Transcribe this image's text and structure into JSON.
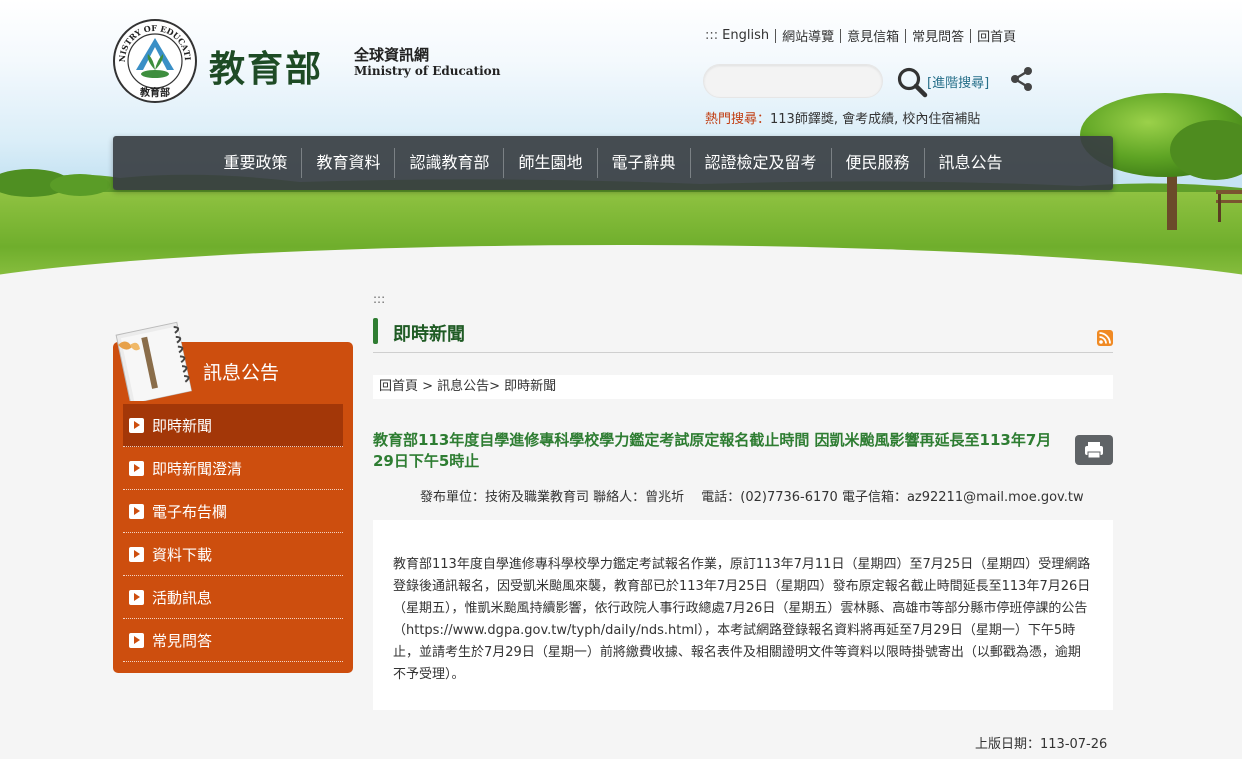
{
  "header": {
    "logo_ring_text": "MINISTRY OF EDUCATION",
    "logo_bottom_text": "教育部",
    "brand_zh": "教育部",
    "brand_sub": "全球資訊網",
    "brand_en": "Ministry of Education"
  },
  "toplinks": {
    "accesskey": ":::",
    "items": [
      "English",
      "網站導覽",
      "意見信箱",
      "常見問答",
      "回首頁"
    ]
  },
  "search": {
    "value": "",
    "placeholder": "",
    "advanced_label": "[進階搜尋]"
  },
  "hot": {
    "label": "熱門搜尋：",
    "keywords": "113師鐸獎, 會考成績, 校內住宿補貼"
  },
  "nav": {
    "items": [
      "重要政策",
      "教育資料",
      "認識教育部",
      "師生園地",
      "電子辭典",
      "認證檢定及留考",
      "便民服務",
      "訊息公告"
    ]
  },
  "sidebar": {
    "title": "訊息公告",
    "items": [
      "即時新聞",
      "即時新聞澄清",
      "電子布告欄",
      "資料下載",
      "活動訊息",
      "常見問答"
    ],
    "active_index": 0
  },
  "content": {
    "accesskey": ":::",
    "page_title": "即時新聞",
    "breadcrumb": "回首頁 > 訊息公告> 即時新聞",
    "news_title": "教育部113年度自學進修專科學校學力鑑定考試原定報名截止時間 因凱米颱風影響再延長至113年7月29日下午5時止",
    "meta": "發布單位：技術及職業教育司 聯絡人：曾兆圻　 電話：(02)7736-6170 電子信箱：az92211@mail.moe.gov.tw",
    "body": "教育部113年度自學進修專科學校學力鑑定考試報名作業，原訂113年7月11日（星期四）至7月25日（星期四）受理網路登錄後通訊報名，因受凱米颱風來襲，教育部已於113年7月25日（星期四）發布原定報名截止時間延長至113年7月26日（星期五），惟凱米颱風持續影響，依行政院人事行政總處7月26日（星期五）雲林縣、高雄市等部分縣市停班停課的公告（https://www.dgpa.gov.tw/typh/daily/nds.html），本考試網路登錄報名資料將再延至7月29日（星期一）下午5時止，並請考生於7月29日（星期一）前將繳費收據、報名表件及相關證明文件等資料以限時掛號寄出（以郵戳為憑，逾期不予受理）。",
    "post_date": "上版日期：113-07-26"
  },
  "colors": {
    "nav_bg": "#383e42",
    "sidebar_bg": "#cd4e0e",
    "sidebar_active": "#a33708",
    "title_green": "#1f5b24",
    "news_green": "#2e7d32",
    "hot_label": "#c13e12",
    "link_blue": "#28708a"
  },
  "icons": {
    "search": "search-icon",
    "share": "share-icon",
    "rss": "rss-icon",
    "print": "print-icon",
    "sidebar_bullet": "play-icon"
  }
}
